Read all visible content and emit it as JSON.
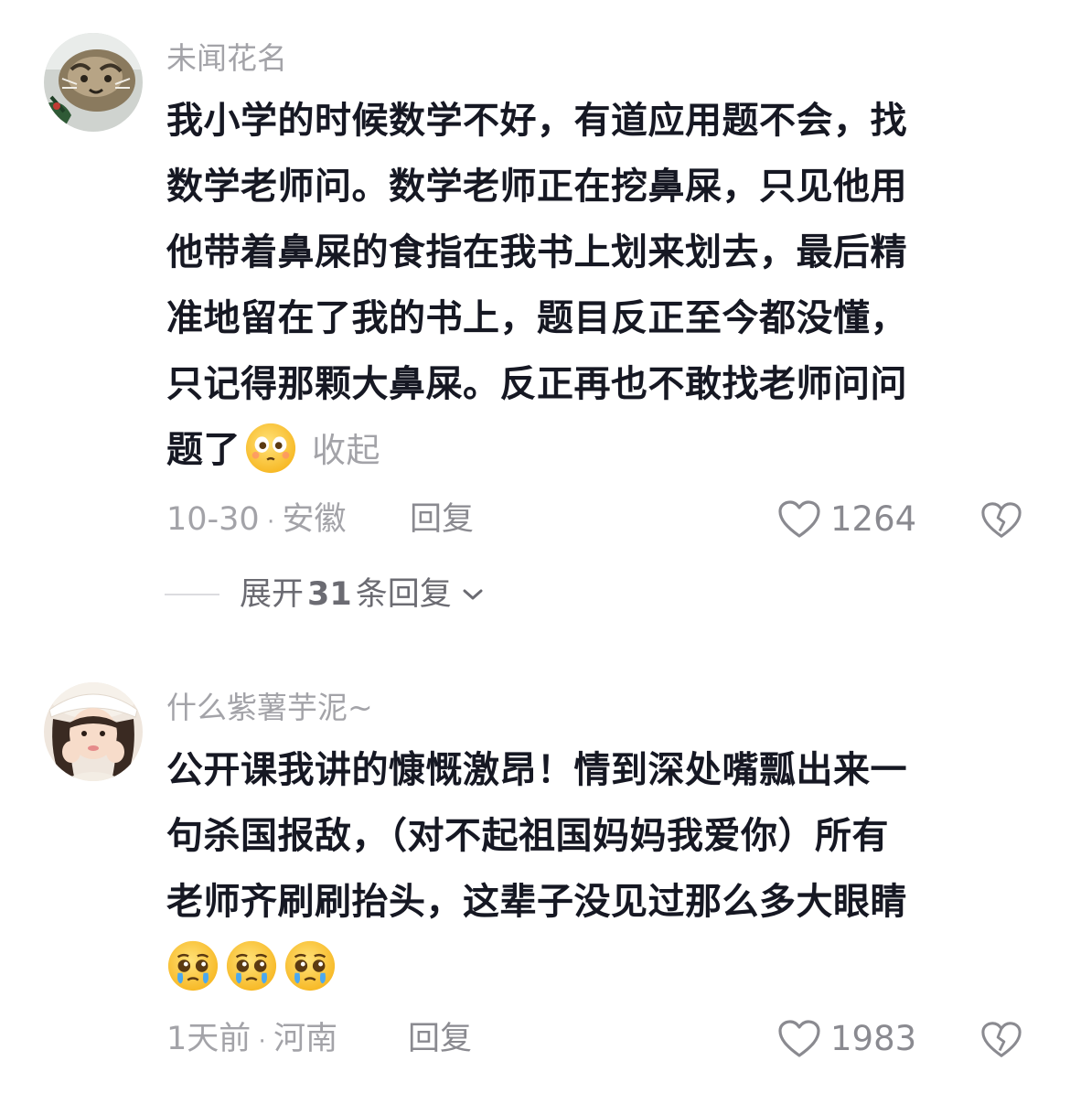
{
  "comments": [
    {
      "username": "未闻花名",
      "avatar_icon": "cat-avatar",
      "lines": [
        "我小学的时候数学不好，有道应用题不会，找",
        "数学老师问。数学老师正在挖鼻屎，只见他用",
        "他带着鼻屎的食指在我书上划来划去，最后精",
        "准地留在了我的书上，题目反正至今都没懂，",
        "只记得那颗大鼻屎。反正再也不敢找老师问问",
        "题了"
      ],
      "emojis": [
        "dazed-face-emoji"
      ],
      "collapse_label": "收起",
      "date": "10-30",
      "location": "安徽",
      "reply_label": "回复",
      "likes": "1264",
      "expand": {
        "prefix": "展开",
        "count": "31",
        "suffix": "条回复"
      }
    },
    {
      "username": "什么紫薯芋泥~",
      "avatar_icon": "girl-avatar",
      "lines": [
        "公开课我讲的慷慨激昂！情到深处嘴瓢出来一",
        "句杀国报敌，（对不起祖国妈妈我爱你）所有",
        "老师齐刷刷抬头，这辈子没见过那么多大眼睛"
      ],
      "emojis": [
        "pleading-face-emoji",
        "pleading-face-emoji",
        "pleading-face-emoji"
      ],
      "date": "1天前",
      "location": "河南",
      "reply_label": "回复",
      "likes": "1983"
    }
  ],
  "colors": {
    "text_primary": "#161823",
    "text_secondary": "#a3a3a8",
    "meta_dark": "#8a8a90",
    "background": "#ffffff"
  }
}
